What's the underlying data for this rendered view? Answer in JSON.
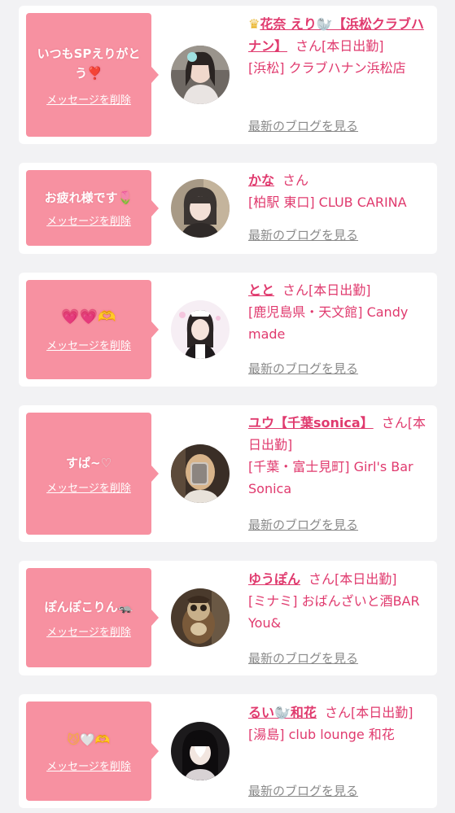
{
  "delete_label": "メッセージを削除",
  "blog_label": "最新のブログを見る",
  "san_label": "さん",
  "colors": {
    "bubble": "#f791a1",
    "accent": "#e03a6e",
    "link_gray": "#8a8a8a"
  },
  "messages": [
    {
      "bubble_text": "いつもSPえりがとう",
      "bubble_emoji": "❣️",
      "name_prefix_icon": "crown-icon",
      "name": "花奈 えり🦭【浜松クラブハナン】",
      "badge": "[本日出勤]",
      "shop": "[浜松] クラブハナン浜松店"
    },
    {
      "bubble_text": "お疲れ様です",
      "bubble_emoji": "🌷",
      "name": "かな",
      "badge": "",
      "shop": "[柏駅 東口] CLUB CARINA"
    },
    {
      "bubble_text": "",
      "bubble_emoji": "💗💗🫶",
      "name": "とと",
      "badge": "[本日出勤]",
      "shop": "[鹿児島県・天文館] Candy made"
    },
    {
      "bubble_text": "すぱ~",
      "bubble_emoji": "♡",
      "name": "ユウ【千葉sonica】",
      "badge": "[本日出勤]",
      "shop": "[千葉・富士見町] Girl's Bar Sonica"
    },
    {
      "bubble_text": "ぽんぽこりん",
      "bubble_emoji": "🦡",
      "name": "ゆうぽん",
      "badge": "[本日出勤]",
      "shop": "[ミナミ] おばんざいと酒BAR You&"
    },
    {
      "bubble_text": "",
      "bubble_emoji": "😼🤍🫶",
      "name": "るい🦭和花",
      "badge": "[本日出勤]",
      "shop": "[湯島] club lounge 和花"
    }
  ]
}
